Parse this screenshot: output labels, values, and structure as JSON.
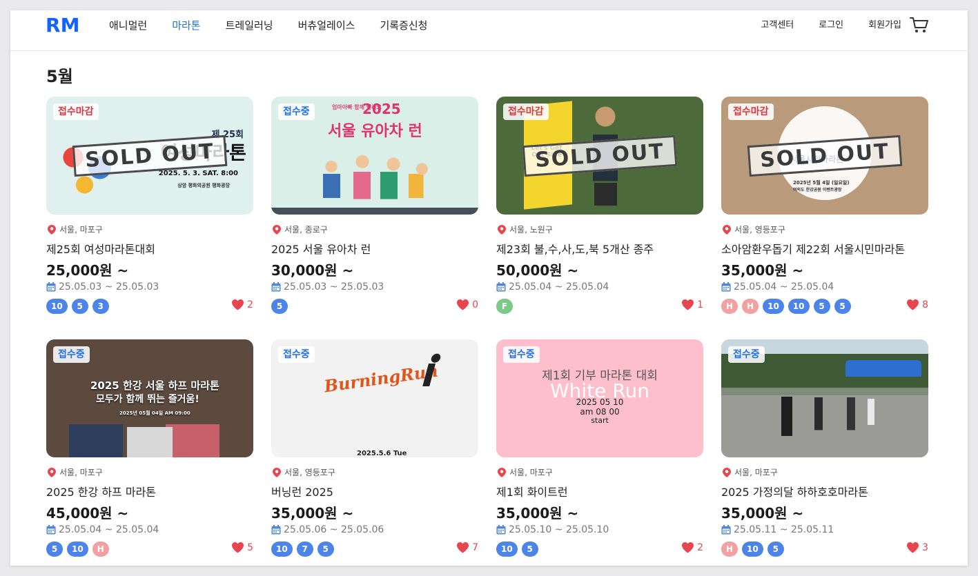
{
  "header": {
    "logo": [
      "R",
      "M"
    ],
    "nav": [
      "애니멀런",
      "마라톤",
      "트레일러닝",
      "버츄얼레이스",
      "기록증신청"
    ],
    "active_nav": "마라톤",
    "util": [
      "고객센터",
      "로그인",
      "회원가입"
    ],
    "cart_icon": "cart-icon"
  },
  "month_title": "5월",
  "colors": {
    "accent": "#1c6ef2",
    "closed": "#e0333f",
    "heart": "#e8464e",
    "tag_blue": "#4d84ea",
    "tag_pink": "#f2a0a0",
    "tag_green": "#7dc987"
  },
  "events": [
    {
      "status": "접수마감",
      "status_type": "closed",
      "location": "서울, 마포구",
      "title": "제25회 여성마라톤대회",
      "price": "25,000원 ~",
      "dates": "25.05.03 ~ 25.05.03",
      "tags": [
        {
          "text": "10",
          "color": "blue"
        },
        {
          "text": "5",
          "color": "blue"
        },
        {
          "text": "3",
          "color": "blue"
        }
      ],
      "likes": "2",
      "image": {
        "bg": "#dff0ee",
        "texts": [
          "제 25회",
          "여성마라톤",
          "2025. 5. 3. SAT. 8:00",
          "상암 평화의공원 평화광장"
        ],
        "soldout": "SOLD OUT"
      }
    },
    {
      "status": "접수중",
      "status_type": "open",
      "location": "서울, 종로구",
      "title": "2025 서울 유아차 런",
      "price": "30,000원 ~",
      "dates": "25.05.03 ~ 25.05.03",
      "tags": [
        {
          "text": "5",
          "color": "blue"
        }
      ],
      "likes": "0",
      "image": {
        "bg": "#d9efe8",
        "texts": [
          "엄마아빠 함께 달려요",
          "2025",
          "서울 유아차 런"
        ]
      }
    },
    {
      "status": "접수마감",
      "status_type": "closed",
      "location": "서울, 노원구",
      "title": "제23회 불,수,사,도,북 5개산 종주",
      "price": "50,000원 ~",
      "dates": "25.05.04 ~ 25.05.04",
      "tags": [
        {
          "text": "F",
          "color": "green"
        }
      ],
      "likes": "1",
      "image": {
        "bg": "#4d6b3a",
        "texts": [
          "Let's Get Out Side !"
        ],
        "soldout": "SOLD OUT"
      }
    },
    {
      "status": "접수마감",
      "status_type": "closed",
      "location": "서울, 영등포구",
      "title": "소아암환우돕기 제22회 서울시민마라톤",
      "price": "35,000원 ~",
      "dates": "25.05.04 ~ 25.05.04",
      "tags": [
        {
          "text": "H",
          "color": "pink"
        },
        {
          "text": "H",
          "color": "pink"
        },
        {
          "text": "10",
          "color": "blue"
        },
        {
          "text": "10",
          "color": "blue"
        },
        {
          "text": "5",
          "color": "blue"
        },
        {
          "text": "5",
          "color": "blue"
        }
      ],
      "likes": "8",
      "image": {
        "bg": "#b99a7a",
        "texts": [
          "서울시민마라톤",
          "2025년 5월 4일 (일요일)",
          "여의도 한강공원 이벤트광장"
        ],
        "soldout": "SOLD OUT"
      }
    },
    {
      "status": "접수중",
      "status_type": "open",
      "location": "서울, 마포구",
      "title": "2025 한강 하프 마라톤",
      "price": "45,000원 ~",
      "dates": "25.05.04 ~ 25.05.04",
      "tags": [
        {
          "text": "5",
          "color": "blue"
        },
        {
          "text": "10",
          "color": "blue"
        },
        {
          "text": "H",
          "color": "pink"
        }
      ],
      "likes": "5",
      "image": {
        "bg": "#5c4a3e",
        "texts": [
          "2025 한강 서울 하프 마라톤",
          "모두가 함께 뛰는 즐거움!",
          "2025년 05월 04일 AM 09:00"
        ]
      }
    },
    {
      "status": "접수중",
      "status_type": "open",
      "location": "서울, 영등포구",
      "title": "버닝런 2025",
      "price": "35,000원 ~",
      "dates": "25.05.06 ~ 25.05.06",
      "tags": [
        {
          "text": "10",
          "color": "blue"
        },
        {
          "text": "7",
          "color": "blue"
        },
        {
          "text": "5",
          "color": "blue"
        }
      ],
      "likes": "7",
      "image": {
        "bg": "#f2f2f2",
        "texts": [
          "BurningRun",
          "2025.5.6 Tue"
        ]
      }
    },
    {
      "status": "접수중",
      "status_type": "open",
      "location": "서울, 마포구",
      "title": "제1회 화이트런",
      "price": "35,000원 ~",
      "dates": "25.05.10 ~ 25.05.10",
      "tags": [
        {
          "text": "10",
          "color": "blue"
        },
        {
          "text": "5",
          "color": "blue"
        }
      ],
      "likes": "2",
      "image": {
        "bg": "#fdbfcb",
        "texts": [
          "제1회 기부 마라톤 대회",
          "White Run",
          "2025 05 10",
          "am 08 00",
          "start"
        ]
      }
    },
    {
      "status": "접수중",
      "status_type": "open",
      "location": "서울, 마포구",
      "title": "2025 가정의달 하하호호마라톤",
      "price": "35,000원 ~",
      "dates": "25.05.11 ~ 25.05.11",
      "tags": [
        {
          "text": "H",
          "color": "pink"
        },
        {
          "text": "10",
          "color": "blue"
        },
        {
          "text": "5",
          "color": "blue"
        }
      ],
      "likes": "3",
      "image": {
        "bg": "#7f8a7a",
        "texts": []
      }
    }
  ]
}
